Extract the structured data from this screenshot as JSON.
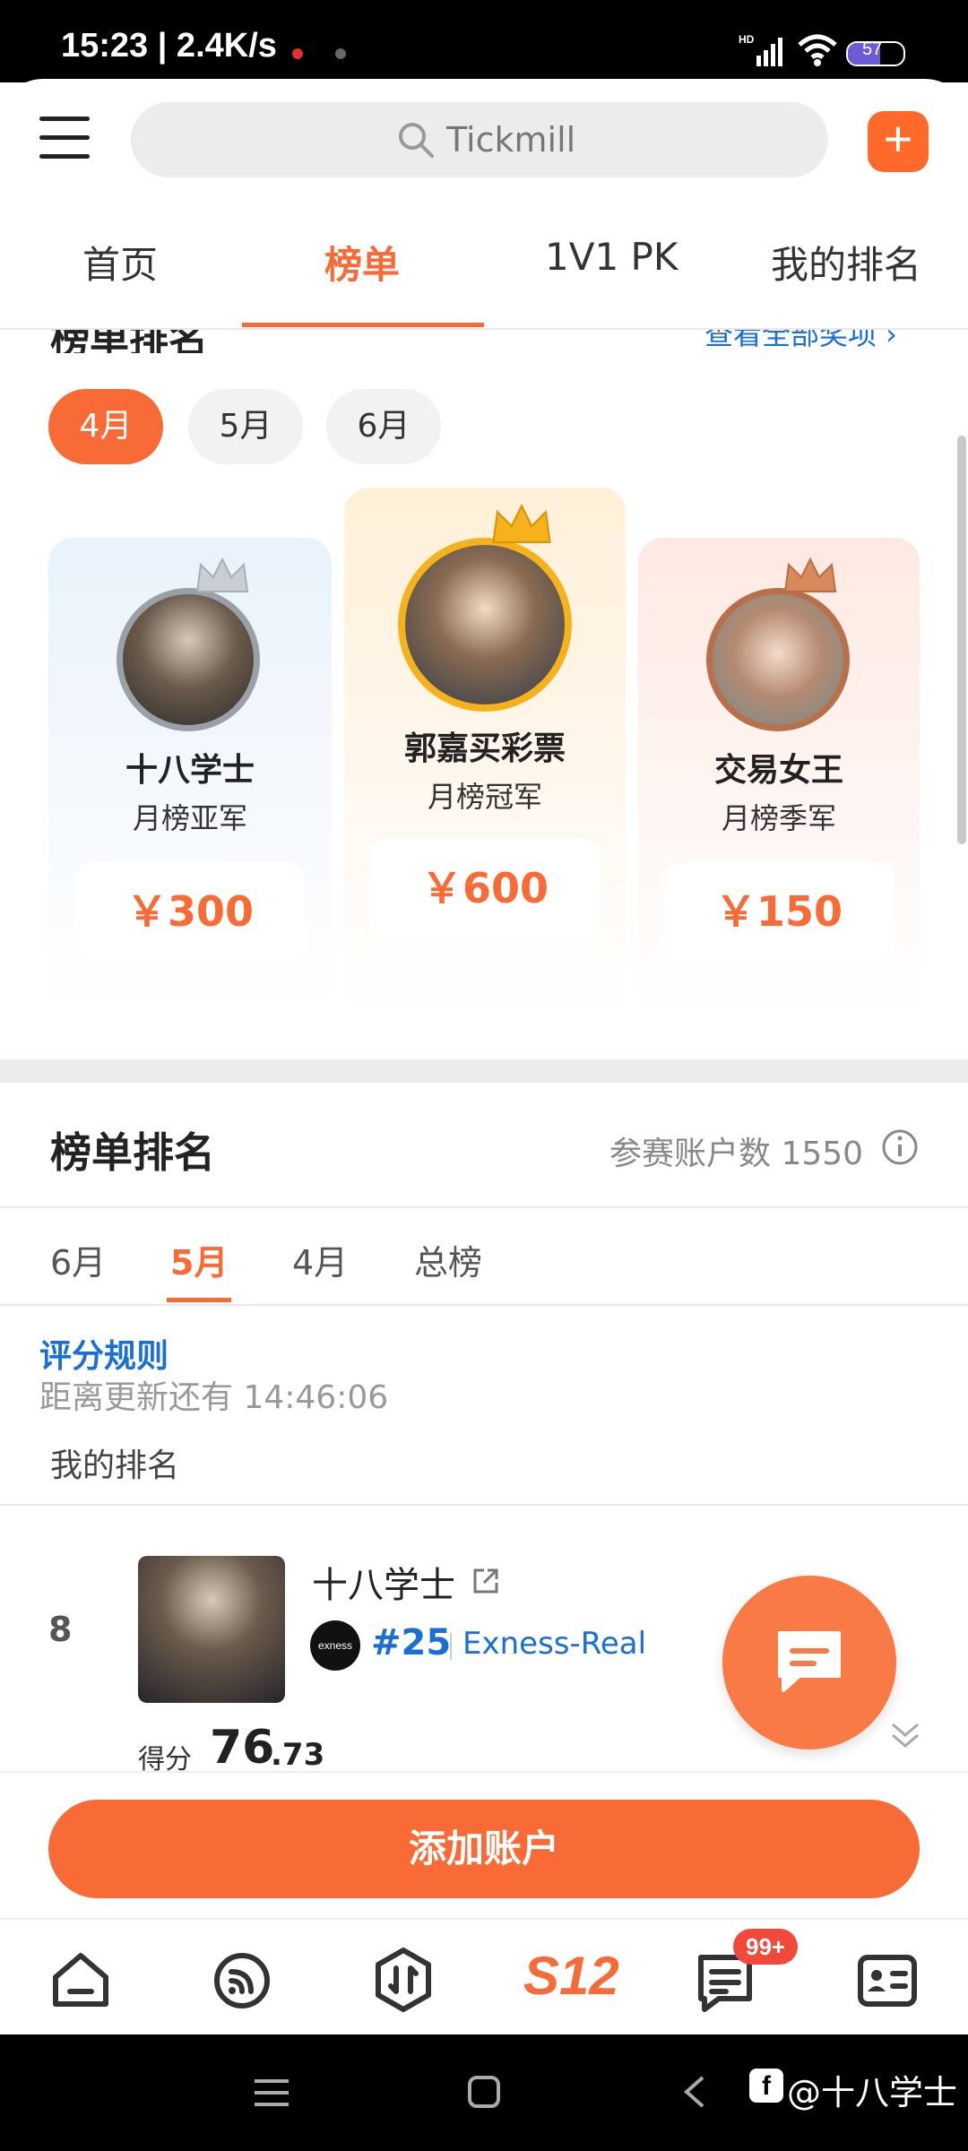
{
  "status_bar": {
    "time": "15:23 | 2.4K/s",
    "battery": "57"
  },
  "header": {
    "search_placeholder": "Tickmill"
  },
  "top_tabs": [
    {
      "label": "首页"
    },
    {
      "label": "榜单",
      "active": true
    },
    {
      "label": "1V1 PK"
    },
    {
      "label": "我的排名"
    }
  ],
  "prize_section": {
    "title": "榜单排名",
    "view_all": "查看全部奖项 ›",
    "months": [
      "4月",
      "5月",
      "6月"
    ],
    "selected_month": "4月",
    "podium": [
      {
        "name": "十八学士",
        "rank": "月榜亚军",
        "prize": "￥300",
        "crown_color": "#c9ced6"
      },
      {
        "name": "郭嘉买彩票",
        "rank": "月榜冠军",
        "prize": "￥600",
        "crown_color": "#f6b21b"
      },
      {
        "name": "交易女王",
        "rank": "月榜季军",
        "prize": "￥150",
        "crown_color": "#d88a5c"
      }
    ]
  },
  "ranking": {
    "title": "榜单排名",
    "participants": "参赛账户数 1550",
    "tabs": [
      "6月",
      "5月",
      "4月",
      "总榜"
    ],
    "active_tab": "5月",
    "rules_link": "评分规则",
    "countdown": "距离更新还有 14:46:06",
    "my_rank_label": "我的排名",
    "entry": {
      "rank": "8",
      "name": "十八学士",
      "number": "#25",
      "account": "Exness-Real",
      "score_label": "得分",
      "score_int": "76",
      "score_dec": ".73"
    }
  },
  "add_account_button": "添加账户",
  "bottom_nav": {
    "badge": "99+",
    "brand_label": "S12"
  },
  "watermark": "@十八学士",
  "colors": {
    "accent": "#f96b36",
    "link": "#1a6fd6"
  }
}
